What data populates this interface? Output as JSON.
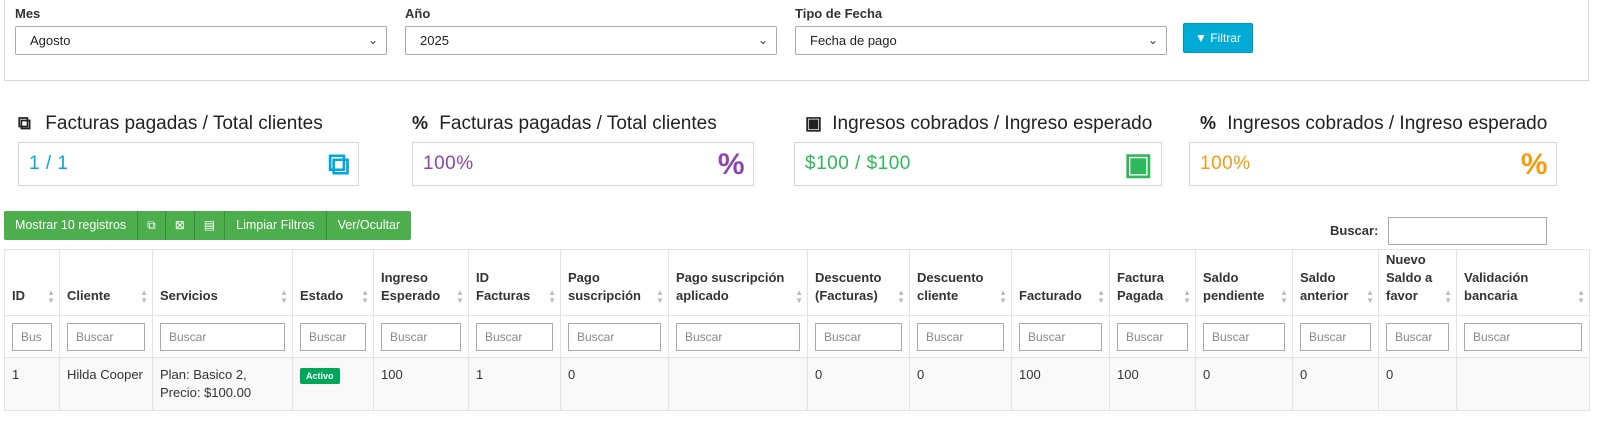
{
  "filters": {
    "month": {
      "label": "Mes",
      "value": "Agosto"
    },
    "year": {
      "label": "Año",
      "value": "2025"
    },
    "date_type": {
      "label": "Tipo de Fecha",
      "value": "Fecha de pago"
    },
    "filter_button": "Filtrar"
  },
  "kpis": [
    {
      "title": "Facturas pagadas / Total clientes",
      "value": "1 / 1",
      "color": "#00a7e0",
      "icon": "copy-icon",
      "title_glyph": "⧉",
      "box_glyph": "⧉"
    },
    {
      "title": "Facturas pagadas / Total clientes",
      "value": "100%",
      "color": "#8e44ad",
      "icon": "percent-icon",
      "title_glyph": "%",
      "box_glyph": "%"
    },
    {
      "title": "Ingresos cobrados / Ingreso esperado",
      "value": "$100 / $100",
      "color": "#2eb85c",
      "icon": "money-icon",
      "title_glyph": "▣",
      "box_glyph": "▣"
    },
    {
      "title": "Ingresos cobrados / Ingreso esperado",
      "value": "100%",
      "color": "#f39c12",
      "icon": "percent-icon",
      "title_glyph": "%",
      "box_glyph": "%"
    }
  ],
  "toolbar": {
    "show_records": "Mostrar 10 registros",
    "icon_copy": "⧉",
    "icon_excel": "⊠",
    "icon_pdf": "▤",
    "clear_filters": "Limpiar Filtros",
    "toggle_columns": "Ver/Ocultar",
    "color": "#4cae4c"
  },
  "search": {
    "label": "Buscar:"
  },
  "table": {
    "columns": [
      "ID",
      "Cliente",
      "Servicios",
      "Estado",
      "Ingreso Esperado",
      "ID Facturas",
      "Pago suscripción",
      "Pago suscripción aplicado",
      "Descuento (Facturas)",
      "Descuento cliente",
      "Facturado",
      "Factura Pagada",
      "Saldo pendiente",
      "Saldo anterior",
      "Nuevo Saldo a favor",
      "Validación bancaria"
    ],
    "filter_placeholder": "Buscar",
    "filter_placeholder_short": "Bus",
    "rows": [
      {
        "id": "1",
        "cliente": "Hilda Cooper",
        "servicios_line1": "Plan: Basico 2,",
        "servicios_line2": "Precio: $100.00",
        "estado": "Activo",
        "ingreso_esperado": "100",
        "id_facturas": "1",
        "pago_suscripcion": "0",
        "pago_suscripcion_aplicado": "",
        "descuento_facturas": "0",
        "descuento_cliente": "0",
        "facturado": "100",
        "factura_pagada": "100",
        "saldo_pendiente": "0",
        "saldo_anterior": "0",
        "nuevo_saldo_favor": "0",
        "validacion_bancaria": ""
      }
    ]
  }
}
